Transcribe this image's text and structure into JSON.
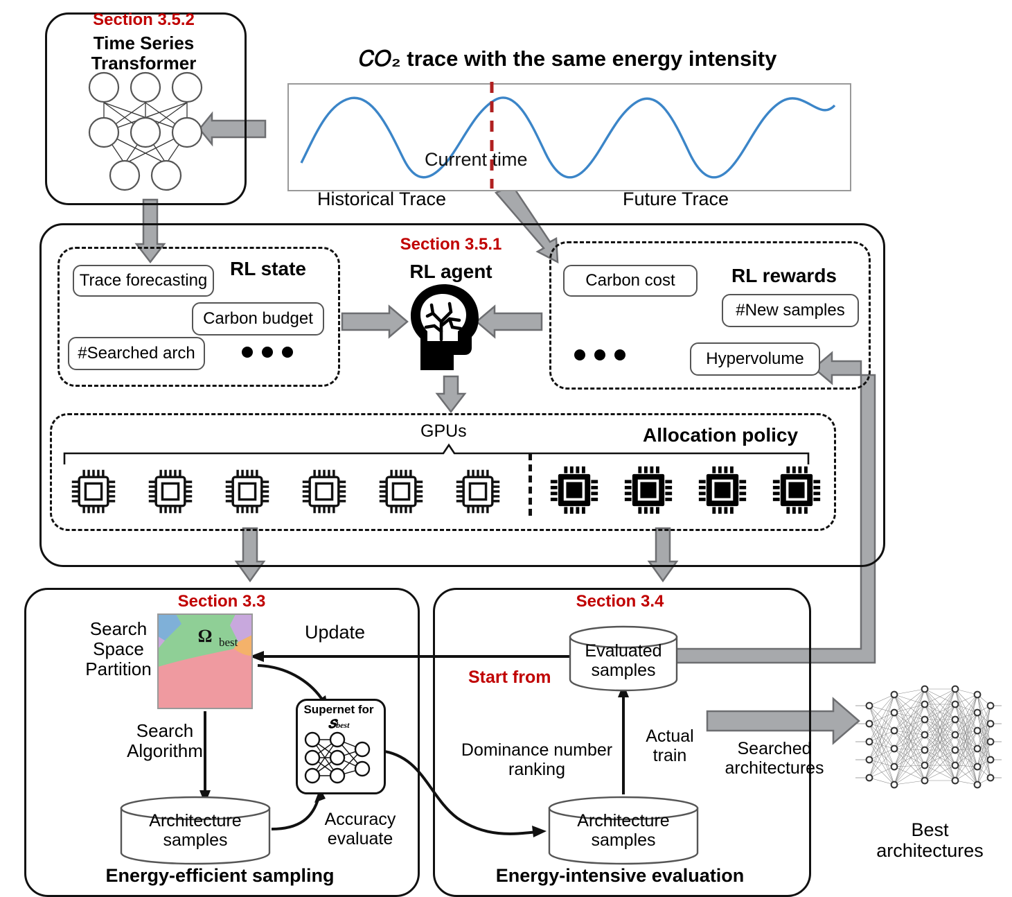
{
  "figure": {
    "title_co2": "𝐶𝑂₂ trace with the same energy intensity",
    "sections": {
      "tst": "Section 3.5.2",
      "rl_agent": "Section 3.5.1",
      "sampling": "Section 3.3",
      "evaluation": "Section 3.4"
    }
  },
  "tst_box": {
    "title": "Time Series\nTransformer",
    "icon": "neural-network-icon",
    "layers": [
      3,
      3,
      2
    ]
  },
  "trace": {
    "title": "𝐶𝑂₂ trace with the same energy intensity",
    "current_time_label": "Current time",
    "historical_label": "Historical Trace",
    "future_label": "Future Trace",
    "line_color": "#3b85c8",
    "divider_color": "#b02020"
  },
  "rl_state": {
    "title": "RL state",
    "items": [
      "Trace forecasting",
      "Carbon budget",
      "#Searched arch"
    ],
    "ellipsis": "•••"
  },
  "rl_agent": {
    "title": "RL agent",
    "icon": "brain-head-icon"
  },
  "rl_rewards": {
    "title": "RL rewards",
    "items": [
      "Carbon cost",
      "#New samples",
      "Hypervolume"
    ],
    "ellipsis": "•••"
  },
  "allocation": {
    "title": "Allocation policy",
    "gpus_label": "GPUs",
    "idle_count": 6,
    "active_count": 4,
    "idle_icon": "chip-outline-icon",
    "active_icon": "chip-filled-icon"
  },
  "sampling_panel": {
    "section": "Section 3.3",
    "footer": "Energy-efficient sampling",
    "search_space_label": "Search\nSpace\nPartition",
    "partition_label": "Ω",
    "partition_sub": "best",
    "search_algorithm_label": "Search\nAlgorithm",
    "db_label": "Architecture\nsamples",
    "supernet_title": "Supernet for",
    "supernet_sub": "S",
    "supernet_sub2": "best",
    "accuracy_label": "Accuracy\nevaluate",
    "update_label": "Update",
    "partition_colors": [
      "#7fb0d8",
      "#8fcf96",
      "#c8a8dd",
      "#f4b26a",
      "#ef9aa0"
    ]
  },
  "evaluation_panel": {
    "section": "Section 3.4",
    "footer": "Energy-intensive evaluation",
    "start_from_label": "Start from",
    "evaluated_db": "Evaluated\nsamples",
    "arch_db": "Architecture\nsamples",
    "actual_train_label": "Actual\ntrain",
    "dominance_label": "Dominance number\nranking"
  },
  "output": {
    "searched_label": "Searched\narchitectures",
    "best_label": "Best\narchitectures",
    "icon": "deep-neural-network-icon"
  },
  "colors": {
    "arrow_gray": "#a7a9ac",
    "arrow_gray_border": "#6d6e71",
    "red": "#c00000",
    "black": "#111111"
  }
}
